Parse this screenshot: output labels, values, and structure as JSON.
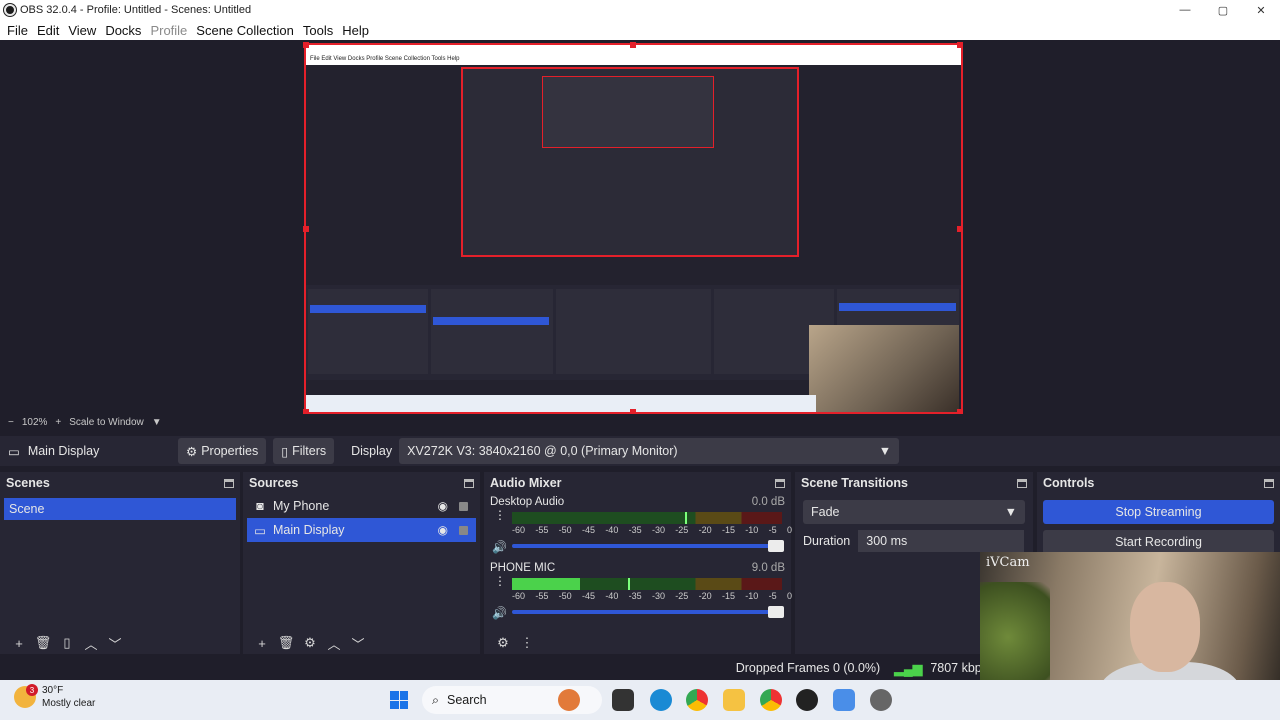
{
  "window": {
    "title": "OBS 32.0.4 - Profile: Untitled - Scenes: Untitled",
    "minimize": "—",
    "maximize": "▢",
    "close": "✕"
  },
  "menu": [
    "File",
    "Edit",
    "View",
    "Docks",
    "Profile",
    "Scene Collection",
    "Tools",
    "Help"
  ],
  "zoom": {
    "minus": "−",
    "level": "102%",
    "plus": "+",
    "mode": "Scale to Window"
  },
  "context": {
    "source_name": "Main Display",
    "properties": "Properties",
    "filters": "Filters",
    "display_label": "Display",
    "display_value": "XV272K V3: 3840x2160 @ 0,0 (Primary Monitor)"
  },
  "scenes": {
    "title": "Scenes",
    "items": [
      "Scene"
    ]
  },
  "sources": {
    "title": "Sources",
    "items": [
      {
        "name": "My Phone",
        "icon": "camera-icon"
      },
      {
        "name": "Main Display",
        "icon": "monitor-icon"
      }
    ]
  },
  "mixer": {
    "title": "Audio Mixer",
    "ticks": [
      "-60",
      "-55",
      "-50",
      "-45",
      "-40",
      "-35",
      "-30",
      "-25",
      "-20",
      "-15",
      "-10",
      "-5",
      "0"
    ],
    "channels": [
      {
        "name": "Desktop Audio",
        "db": "0.0 dB",
        "level": 0.0,
        "peak": 0.64
      },
      {
        "name": "PHONE MIC",
        "db": "9.0 dB",
        "level": 0.25,
        "peak": 0.43
      }
    ]
  },
  "transitions": {
    "title": "Scene Transitions",
    "type": "Fade",
    "duration_label": "Duration",
    "duration_value": "300 ms"
  },
  "controls": {
    "title": "Controls",
    "stop_streaming": "Stop Streaming",
    "start_recording": "Start Recording"
  },
  "status": {
    "dropped": "Dropped Frames 0 (0.0%)",
    "bitrate": "7807 kbps"
  },
  "webcam": {
    "watermark": "iVCam"
  },
  "taskbar": {
    "temp": "30°F",
    "condition": "Mostly clear",
    "badge": "3",
    "search": "Search"
  },
  "colors": {
    "accent": "#2f57d6",
    "panel": "#272634",
    "background": "#1f1e2a",
    "selection_border": "#e4202a"
  }
}
